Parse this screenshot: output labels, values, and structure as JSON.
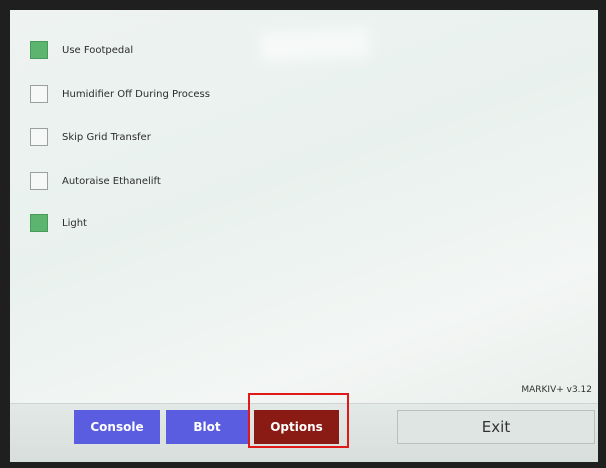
{
  "options": [
    {
      "label": "Use Footpedal",
      "checked": true
    },
    {
      "label": "Humidifier Off During Process",
      "checked": false
    },
    {
      "label": "Skip Grid Transfer",
      "checked": false
    },
    {
      "label": "Autoraise Ethanelift",
      "checked": false
    },
    {
      "label": "Light",
      "checked": true
    }
  ],
  "version": "MARKIV+ v3.12",
  "buttons": {
    "console": "Console",
    "blot": "Blot",
    "options": "Options",
    "exit": "Exit"
  },
  "colors": {
    "checked": "#5bb56f",
    "nav_button": "#5a5de0",
    "active_button": "#8a1a14",
    "highlight": "#e01818"
  }
}
